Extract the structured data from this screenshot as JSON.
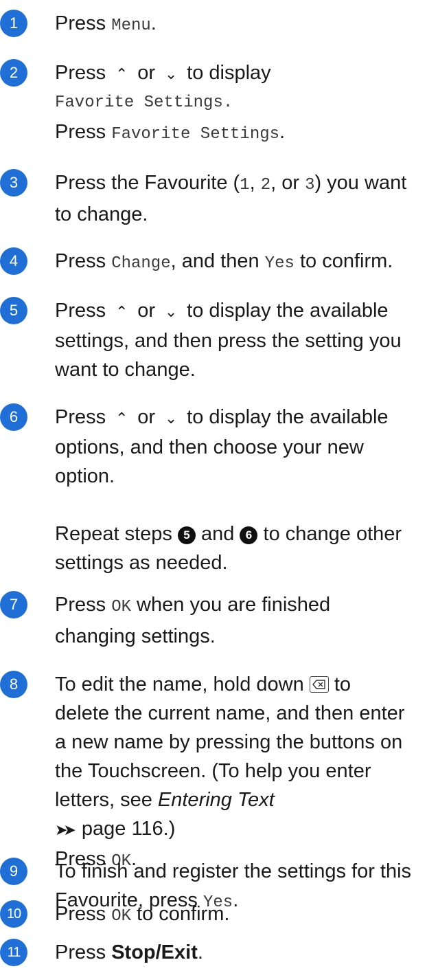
{
  "steps": [
    {
      "num": "1",
      "a": "Press ",
      "b": "Menu",
      "c": "."
    },
    {
      "num": "2",
      "l1a": "Press ",
      "l1b": " or ",
      "l1c": " to display",
      "l2": "Favorite Settings.",
      "l3a": "Press ",
      "l3b": "Favorite Settings",
      "l3c": "."
    },
    {
      "num": "3",
      "l1a": "Press the Favourite (",
      "l1b": "1",
      "l1c": ", ",
      "l1d": "2",
      "l1e": ", or ",
      "l1f": "3",
      "l1g": ") you want",
      "l2": "to change."
    },
    {
      "num": "4",
      "a": "Press ",
      "b": "Change",
      "c": ", and then ",
      "d": "Yes",
      "e": " to confirm."
    },
    {
      "num": "5",
      "l1a": "Press ",
      "l1b": " or ",
      "l1c": " to display the available",
      "l2": "settings, and then press the setting you",
      "l3": "want to change."
    },
    {
      "num": "6",
      "l1a": "Press ",
      "l1b": " or ",
      "l1c": " to display the available",
      "l2": "options, and then choose your new",
      "l3": "option.",
      "r1a": "Repeat steps ",
      "r1b": "5",
      "r1c": " and ",
      "r1d": "6",
      "r1e": " to change other",
      "r2": "settings as needed."
    },
    {
      "num": "7",
      "l1a": "Press ",
      "l1b": "OK",
      "l1c": " when you are finished",
      "l2": "changing settings."
    },
    {
      "num": "8",
      "l1a": "To edit the name, hold down ",
      "l1c": " to",
      "l2": "delete the current name, and then enter",
      "l3": "a new name by pressing the buttons on",
      "l4": "the Touchscreen. (To help you enter",
      "l5a": "letters, see ",
      "l5b": "Entering Text",
      "l6": "page 116.)",
      "l7a": "Press ",
      "l7b": "OK",
      "l7c": "."
    },
    {
      "num": "9",
      "l1": "To finish and register the settings for this",
      "l2a": "Favourite, press ",
      "l2b": "Yes",
      "l2c": "."
    },
    {
      "num": "10",
      "a": "Press ",
      "b": "OK",
      "c": " to confirm."
    },
    {
      "num": "11",
      "a": "Press ",
      "b": "Stop/Exit",
      "c": "."
    }
  ],
  "icons": {
    "up": "chevron-up-icon",
    "down": "chevron-down-icon",
    "backspace": "backspace-key-icon",
    "pageref": "double-arrow-icon"
  }
}
